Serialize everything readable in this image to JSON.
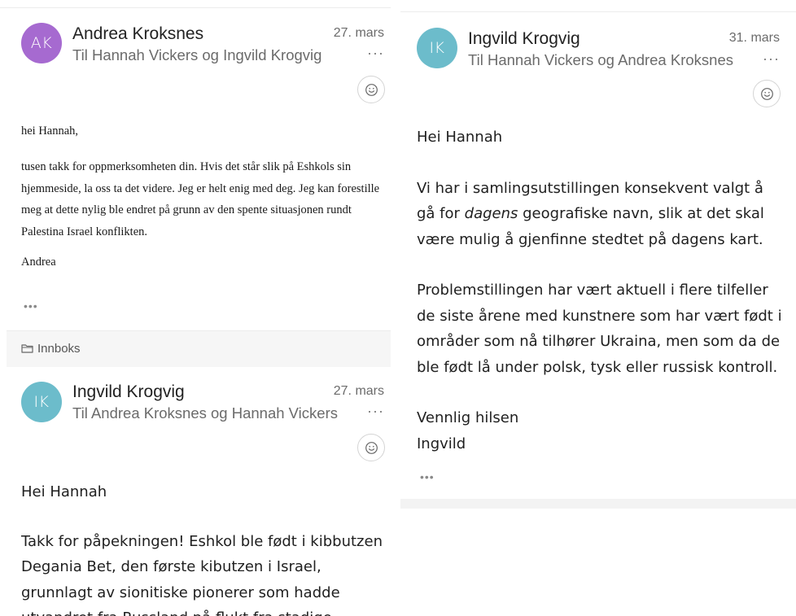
{
  "left_panel": {
    "message1": {
      "avatar_initials": "AK",
      "avatar_color": "#a66ad0",
      "sender": "Andrea Kroksnes",
      "recipients": "Til Hannah Vickers og Ingvild Krogvig",
      "date": "27. mars",
      "more_label": "···",
      "body": [
        "hei Hannah,",
        "tusen takk for oppmerksomheten din. Hvis det står slik på Eshkols sin hjemmeside, la oss ta det videre. Jeg er helt enig med deg. Jeg kan forestille meg at dette nylig ble endret på grunn av den spente situasjonen rundt Palestina Israel konflikten.",
        "Andrea"
      ],
      "expand_label": "•••"
    },
    "folder": {
      "icon": "folder-icon",
      "label": "Innboks"
    },
    "message2": {
      "avatar_initials": "IK",
      "avatar_color": "#6cbccb",
      "sender": "Ingvild Krogvig",
      "recipients": "Til Andrea Kroksnes og Hannah Vickers",
      "date": "27. mars",
      "more_label": "···",
      "body": [
        "Hei Hannah",
        "Takk for påpekningen! Eshkol ble født i kibbutzen Degania Bet, den første kibutzen i Israel, grunnlagt av sionitiske pionerer som hadde utvandret fra Russland på flukt fra stadige"
      ]
    }
  },
  "right_panel": {
    "message": {
      "avatar_initials": "IK",
      "avatar_color": "#6cbccb",
      "sender": "Ingvild Krogvig",
      "recipients": "Til Hannah Vickers og Andrea Kroksnes",
      "date": "31. mars",
      "more_label": "···",
      "greeting": "Hei Hannah",
      "para1_before": "Vi har i samlingsutstillingen konsekvent valgt å gå for ",
      "para1_em": "dagens",
      "para1_after": " geografiske navn, slik at det skal være mulig å gjenfinne stedtet på dagens kart.",
      "para2": "Problemstillingen har vært aktuell i flere tilfeller de siste årene med kunstnere som har vært født i områder som nå tilhører Ukraina, men som da de ble født lå under polsk, tysk eller russisk kontroll.",
      "closing": "Vennlig hilsen",
      "signature": "Ingvild",
      "expand_label": "•••"
    }
  },
  "icons": {
    "reaction": "smiley-icon"
  }
}
